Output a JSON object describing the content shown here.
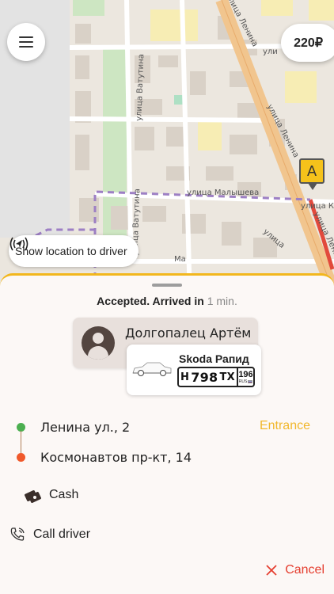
{
  "map": {
    "streets": {
      "lenina_top": "улица Ленина",
      "lenina_mid": "улица Ленина",
      "lenina_bottom": "улица Ленина",
      "vatutina_top": "улица Ватутина",
      "vatutina_bottom": "улица Ватутина",
      "malysheva": "улица Малышева",
      "krasnoarm": "улица Кр",
      "small_top": "ули",
      "ma": "Ма",
      "ulitsa": "улица"
    },
    "marker_label": "A"
  },
  "header": {
    "menu_icon": "hamburger-menu-icon",
    "price": "220₽"
  },
  "show_location": {
    "icon": "location-broadcast-icon",
    "label": "Show location to driver"
  },
  "sheet": {
    "status_prefix": "Accepted. Arrived in",
    "status_eta": "1 min.",
    "driver": {
      "name": "Долгопалец Артём",
      "avatar_icon": "user-avatar-icon"
    },
    "car": {
      "model": "Skoda Рапид",
      "plate": {
        "letter1": "Н",
        "digits": "798",
        "letters2": "ТХ",
        "region": "196",
        "country": "RUS"
      }
    },
    "route": {
      "from": "Ленина ул., 2",
      "to": "Космонавтов пр-кт, 14",
      "entrance": "Entrance",
      "from_color": "#4caf50",
      "to_color": "#f0592b"
    },
    "payment": {
      "icon": "cash-icon",
      "label": "Cash"
    },
    "call": {
      "icon": "phone-call-icon",
      "label": "Call driver"
    },
    "cancel": {
      "icon": "close-icon",
      "label": "Cancel"
    }
  },
  "colors": {
    "accent": "#f2b71d",
    "cancel": "#e53e2f",
    "entrance": "#f1b72b"
  }
}
